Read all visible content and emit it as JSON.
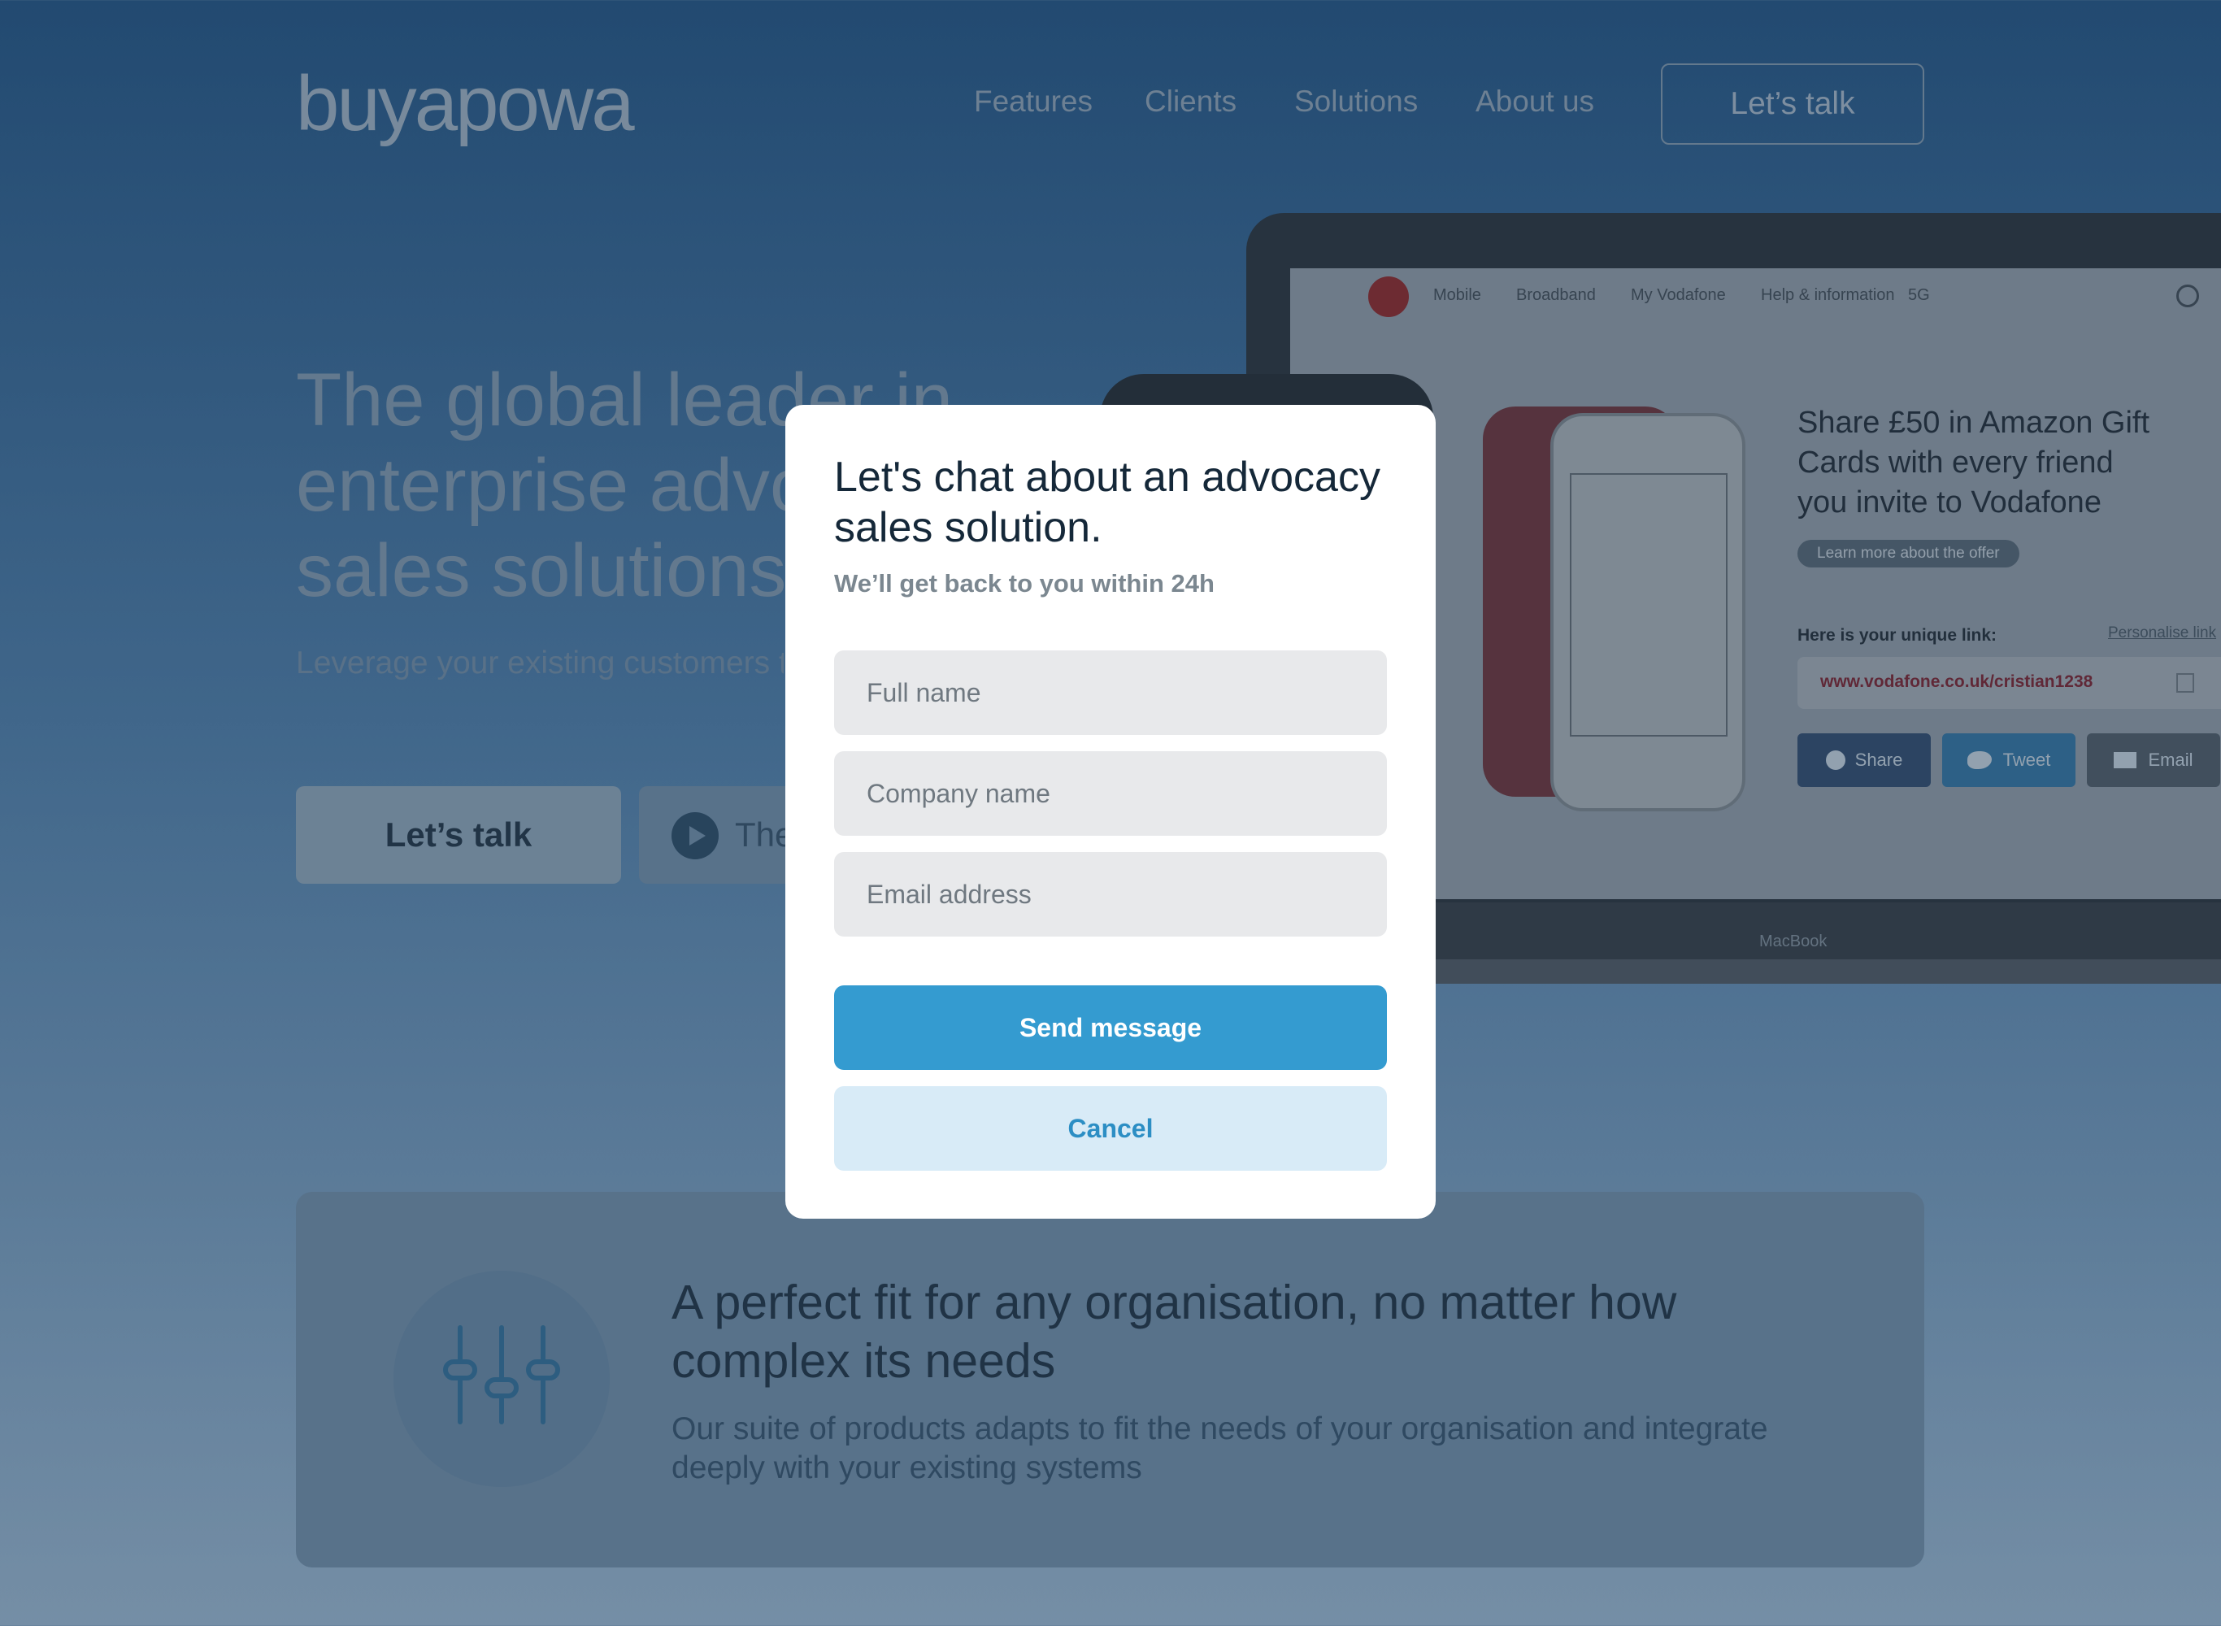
{
  "header": {
    "logo": "buyapowa",
    "nav": [
      "Features",
      "Clients",
      "Solutions",
      "About us"
    ],
    "cta": "Let’s talk"
  },
  "hero": {
    "title": "The global leader in enterprise advocacy sales solutions",
    "subtitle": "Leverage your existing customers to gain new customers. It’s that easy.",
    "primary_button": "Let’s talk",
    "secondary_button": "The"
  },
  "mockup": {
    "vodafone_nav": [
      "Mobile",
      "Broadband",
      "My Vodafone",
      "Help & information",
      "5G"
    ],
    "offer_title": "Share £50 in Amazon Gift Cards with every friend you invite to Vodafone",
    "offer_pill": "Learn more about the offer",
    "link_label": "Here is your unique link:",
    "personalise": "Personalise link",
    "unique_link": "www.vodafone.co.uk/cristian1238",
    "share_buttons": [
      "Share",
      "Tweet",
      "Email"
    ],
    "device_label": "MacBook"
  },
  "feature": {
    "title": "A perfect fit for any organisation, no matter how complex its needs",
    "subtitle": "Our suite of products adapts to fit the needs of your organisation and integrate deeply with your existing systems",
    "icon": "sliders-icon"
  },
  "modal": {
    "title": "Let's chat about an advocacy sales solution.",
    "subtitle": "We’ll get back to you within 24h",
    "fields": {
      "full_name": "Full name",
      "company_name": "Company name",
      "email": "Email address"
    },
    "send": "Send message",
    "cancel": "Cancel"
  },
  "colors": {
    "primary": "#349bd0",
    "secondary_bg": "#d8ebf7",
    "vodafone_red": "#e60000",
    "facebook": "#3b5998",
    "twitter": "#1da1f2"
  }
}
